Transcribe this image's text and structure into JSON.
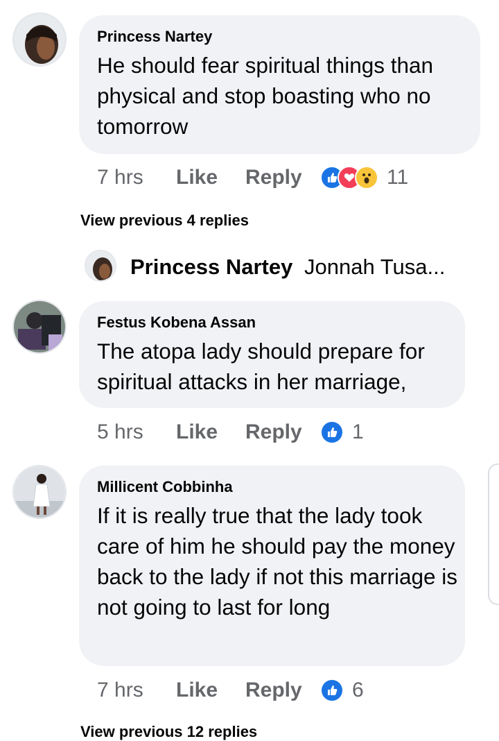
{
  "colors": {
    "bubble": "#f0f2f5",
    "meta": "#65676b",
    "like_blue": "#1b74e4",
    "love_red": "#f33e58",
    "wow_yellow": "#f7c43a"
  },
  "comments": [
    {
      "author": "Princess Nartey",
      "text": "He should fear spiritual things than physical and stop boasting who no tomorrow",
      "time": "7 hrs",
      "like": "Like",
      "reply": "Reply",
      "reactions": [
        "like-icon",
        "love-icon",
        "wow-icon"
      ],
      "reaction_count": "11"
    },
    {
      "author": "Festus Kobena Assan",
      "text": "The atopa lady should prepare for spiritual attacks in her marriage,",
      "time": "5 hrs",
      "like": "Like",
      "reply": "Reply",
      "reactions": [
        "like-icon"
      ],
      "reaction_count": "1"
    },
    {
      "author": "Millicent Cobbinha",
      "text": "If it is really true that the lady took care of him he should pay the money back to the lady if not this marriage is not going to last for long",
      "time": "7 hrs",
      "like": "Like",
      "reply": "Reply",
      "reactions": [
        "like-icon"
      ],
      "reaction_count": "6"
    }
  ],
  "view_previous_1": "View previous 4 replies",
  "reply_preview": {
    "author": "Princess Nartey",
    "snippet": "Jonnah Tusa..."
  },
  "view_previous_2": "View previous 12 replies"
}
